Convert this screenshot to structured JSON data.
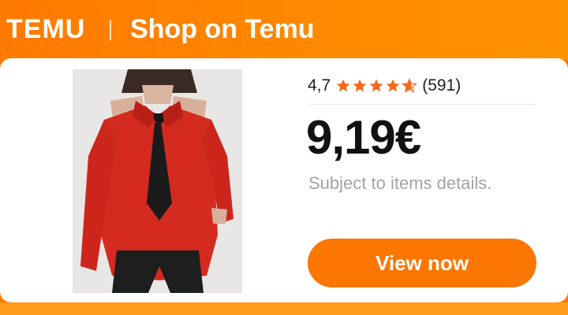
{
  "header": {
    "logo_text": "TEMU",
    "title": "Shop on Temu"
  },
  "product": {
    "image_alt": "red cut-out shoulder shirt with black tie",
    "rating": "4,7",
    "rating_stars": 4.7,
    "review_count": "(591)",
    "price": "9,19€",
    "subtext": "Subject to items details."
  },
  "cta": {
    "label": "View now"
  },
  "colors": {
    "brand_orange": "#fb7701",
    "star_orange": "#f36a1a",
    "price_text": "#111111",
    "subtext_gray": "#a3a3a3"
  },
  "icons": {
    "star": "star-icon",
    "half_star": "half-star-icon"
  }
}
